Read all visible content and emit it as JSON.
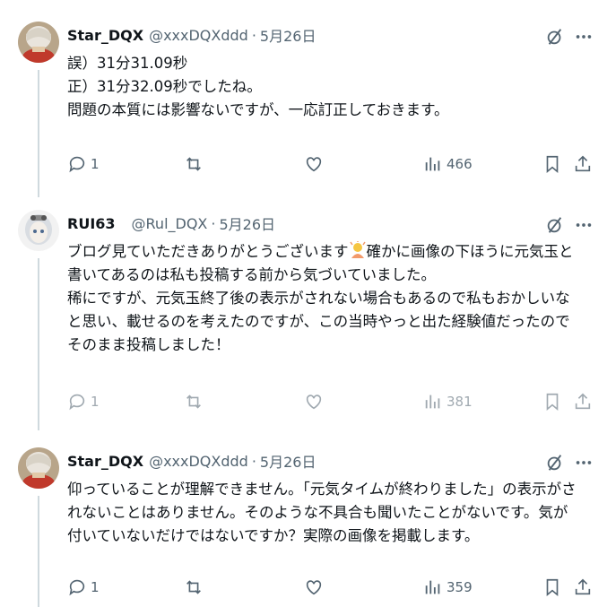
{
  "tweets": [
    {
      "name": "Star_DQX",
      "handle": "@xxxDQXddd",
      "separator": "·",
      "date": "5月26日",
      "lines": [
        "誤）31分31.09秒",
        "正）31分32.09秒でしたね。",
        "問題の本質には影響ないですが、一応訂正しておきます。"
      ],
      "replies": "1",
      "views": "466"
    },
    {
      "name": "RUI63",
      "handle": "@Rul_DQX",
      "separator": "·",
      "date": "5月26日",
      "lines": [
        "ブログ見ていただきありがとうございます",
        "確かに画像の下ほうに元気玉と",
        "書いてあるのは私も投稿する前から気づいていました。",
        "稀にですが、元気玉終了後の表示がされない場合もあるので私もおかしいな",
        "と思い、載せるのを考えたのですが、この当時やっと出た経験値だったので",
        "そのまま投稿しました！"
      ],
      "replies": "1",
      "views": "381"
    },
    {
      "name": "Star_DQX",
      "handle": "@xxxDQXddd",
      "separator": "·",
      "date": "5月26日",
      "lines": [
        "仰っていることが理解できません。「元気タイムが終わりました」の表示がさ",
        "れないことはありません。そのような不具合も聞いたことがないです。気が",
        "付いていないだけではないですか？実際の画像を掲載します。"
      ],
      "replies": "1",
      "views": "359"
    }
  ],
  "colors": {
    "text": "#0f1419",
    "secondary": "#536471",
    "line": "#cfd9de"
  },
  "icons": [
    "reply-icon",
    "retweet-icon",
    "like-icon",
    "views-icon",
    "bookmark-icon",
    "share-icon",
    "grok-icon",
    "more-icon",
    "bowing-person-emoji"
  ]
}
